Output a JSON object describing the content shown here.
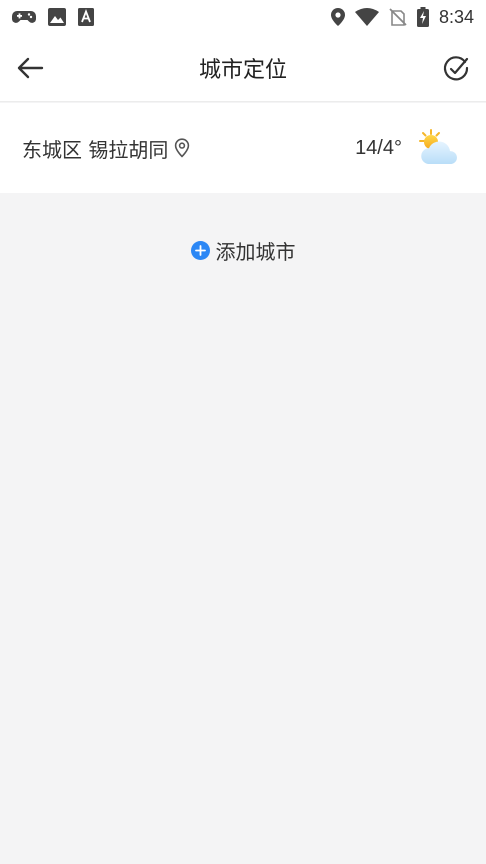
{
  "status_bar": {
    "time": "8:34",
    "left_icons": [
      "gamepad-icon",
      "image-icon",
      "font-a-icon"
    ],
    "right_icons": [
      "location-icon",
      "wifi-icon",
      "no-sim-icon",
      "battery-charging-icon"
    ]
  },
  "header": {
    "title": "城市定位",
    "back_icon": "arrow-left-icon",
    "edit_icon": "check-circle-icon"
  },
  "cities": [
    {
      "name": "东城区 锡拉胡同",
      "temperature": "14/4°",
      "weather_icon": "partly-cloudy-icon",
      "is_location": true
    }
  ],
  "add_city": {
    "label": "添加城市",
    "accent_color": "#2b87f5"
  }
}
